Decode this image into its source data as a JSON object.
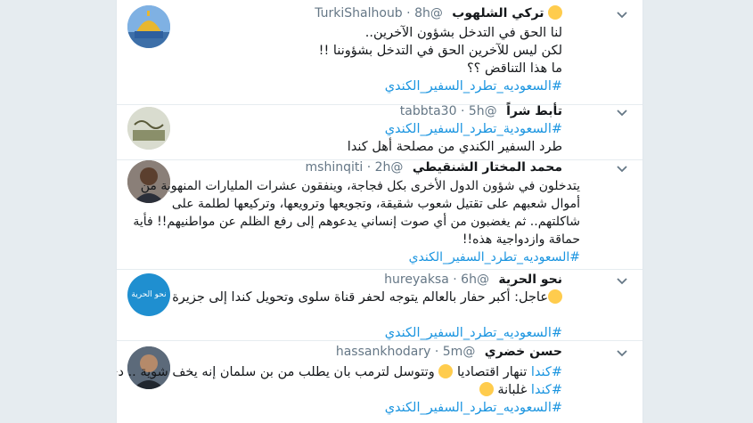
{
  "tweets": [
    {
      "name": "تركي الشلهوب",
      "handle": "@TurkiShalhoub",
      "time": "8h",
      "lines": [
        "لنا الحق في التدخل بشؤون الآخرين..",
        "لكن ليس للآخرين الحق في التدخل بشؤوننا !!",
        "ما هذا التناقض ؟؟"
      ],
      "hashtag": "#السعوديه_تطرد_السفير_الكندي"
    },
    {
      "name": "تأبط شراً",
      "handle": "@tabbta30",
      "time": "5h",
      "hashtag": "#السعودية_تطرد_السفير_الكندي",
      "lines": [
        "طرد السفير الكندي من مصلحة أهل كندا"
      ]
    },
    {
      "name": "محمد المختار الشنقيطي",
      "handle": "@mshinqiti",
      "time": "2h",
      "lines": [
        "يتدخلون في شؤون الدول الأخرى بكل فجاجة، وينفقون عشرات المليارات المنهوبة من",
        "أموال شعبهم على تقتيل شعوب شقيقة، وتجويعها وترويعها، وتركيعها لطلمة على",
        "شاكلتهم.. ثم يغضبون من أي صوت إنساني يدعوهم إلى رفع الظلم عن مواطنيهم!! فأية",
        "حماقة وازدواجية هذه!!"
      ],
      "hashtag": "#السعوديه_تطرد_السفير_الكندي"
    },
    {
      "name": "نحو الحرية",
      "handle": "@hureyaksa",
      "time": "6h",
      "lines": [
        "عاجل: أكبر حفار بالعالم يتوجه لحفر قناة سلوى وتحويل كندا إلى جزيرة"
      ],
      "hashtag": "#السعوديه_تطرد_السفير_الكندي",
      "avatar_text": "نحو الحرية"
    },
    {
      "name": "حسن خضري",
      "handle": "@hassankhodary",
      "time": "5m",
      "line1_tag": "#كندا",
      "line1_text": "تنهار اقتصاديا",
      "line1_rest": "وتتوسل لترمب بان يطلب من بن سلمان إنه يخف شوية .. دي",
      "line2_tag": "#كندا",
      "line2_text": "غلبانة",
      "hashtag": "#السعوديه_تطرد_السفير_الكندي"
    }
  ]
}
